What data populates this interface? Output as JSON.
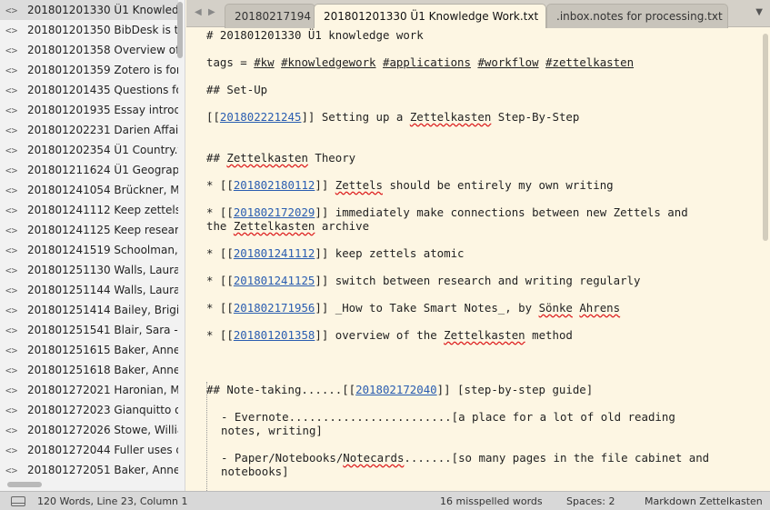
{
  "sidebar": {
    "file_icon_glyph": "<>",
    "items": [
      {
        "label": "201801201330 Ü1 Knowledg",
        "selected": true
      },
      {
        "label": "201801201350 BibDesk is th"
      },
      {
        "label": "201801201358 Overview of t"
      },
      {
        "label": "201801201359 Zotero is for"
      },
      {
        "label": "201801201435 Questions for"
      },
      {
        "label": "201801201935 Essay introdu"
      },
      {
        "label": "201801202231 Darien Affair."
      },
      {
        "label": "201801202354 Ü1 Country.tx"
      },
      {
        "label": "201801211624 Ü1 Geography"
      },
      {
        "label": "201801241054 Brückner, Ma"
      },
      {
        "label": "201801241112 Keep zettels a"
      },
      {
        "label": "201801241125 Keep research"
      },
      {
        "label": "201801241519 Schoolman, M"
      },
      {
        "label": "201801251130 Walls, Laura D"
      },
      {
        "label": "201801251144 Walls, Laura D"
      },
      {
        "label": "201801251414 Bailey, Brigitte"
      },
      {
        "label": "201801251541 Blair, Sara - C"
      },
      {
        "label": "201801251615 Baker, Anne -"
      },
      {
        "label": "201801251618 Baker, Anne -"
      },
      {
        "label": "201801272021 Haronian, Ma"
      },
      {
        "label": "201801272023 Gianquitto or"
      },
      {
        "label": "201801272026 Stowe, Willia"
      },
      {
        "label": "201801272044 Fuller uses d"
      },
      {
        "label": "201801272051 Baker, Anne -"
      }
    ]
  },
  "tabs": [
    {
      "label": "20180217194",
      "active": false
    },
    {
      "label": "201801201330 Ü1 Knowledge Work.txt",
      "active": true
    },
    {
      "label": ".inbox.notes for processing.txt",
      "active": false
    }
  ],
  "tab_close_glyph": "✕",
  "editor": {
    "title": "# 201801201330 Ü1 knowledge work",
    "tags_prefix": "tags = ",
    "tags": [
      "#kw",
      "#knowledgework",
      "#applications",
      "#workflow",
      "#zettelkasten"
    ],
    "setup_heading": "## Set-Up",
    "setup_link_id": "201802221245",
    "setup_text_pre": " Setting up a ",
    "setup_word_zk": "Zettelkasten",
    "setup_text_post": " Step-By-Step",
    "theory_heading_pre": "## ",
    "theory_heading_zk": "Zettelkasten",
    "theory_heading_post": " Theory",
    "bullets": {
      "b1_id": "201802180112",
      "b1_pre": " ",
      "b1_word": "Zettels",
      "b1_post": " should be entirely my own writing",
      "b2_id": "201802172029",
      "b2_text": " immediately make connections between new Zettels and",
      "b2_cont_pre": "the ",
      "b2_cont_word": "Zettelkasten",
      "b2_cont_post": " archive",
      "b3_id": "201801241112",
      "b3_text": " keep zettels atomic",
      "b4_id": "201801241125",
      "b4_text": " switch between research and writing regularly",
      "b5_id": "201802171956",
      "b5_pre": " _How to Take Smart Notes_, by ",
      "b5_word1": "Sönke",
      "b5_space": " ",
      "b5_word2": "Ahrens",
      "b6_id": "201801201358",
      "b6_pre": " overview of the ",
      "b6_word": "Zettelkasten",
      "b6_post": " method"
    },
    "notetaking_pre": "## Note-taking......[[",
    "notetaking_id": "201802172040",
    "notetaking_post": "]] [step-by-step guide]",
    "evernote_line1": "- Evernote........................[a place for a lot of old reading",
    "evernote_line2": "notes, writing]",
    "paper_pre": "- Paper/Notebooks/",
    "paper_word": "Notecards",
    "paper_post": ".......[so many pages in the file cabinet and",
    "paper_line2": "notebooks]"
  },
  "status": {
    "words": "120 Words, Line 23, Column 1",
    "misspelled": "16 misspelled words",
    "spaces": "Spaces: 2",
    "syntax": "Markdown Zettelkasten"
  }
}
